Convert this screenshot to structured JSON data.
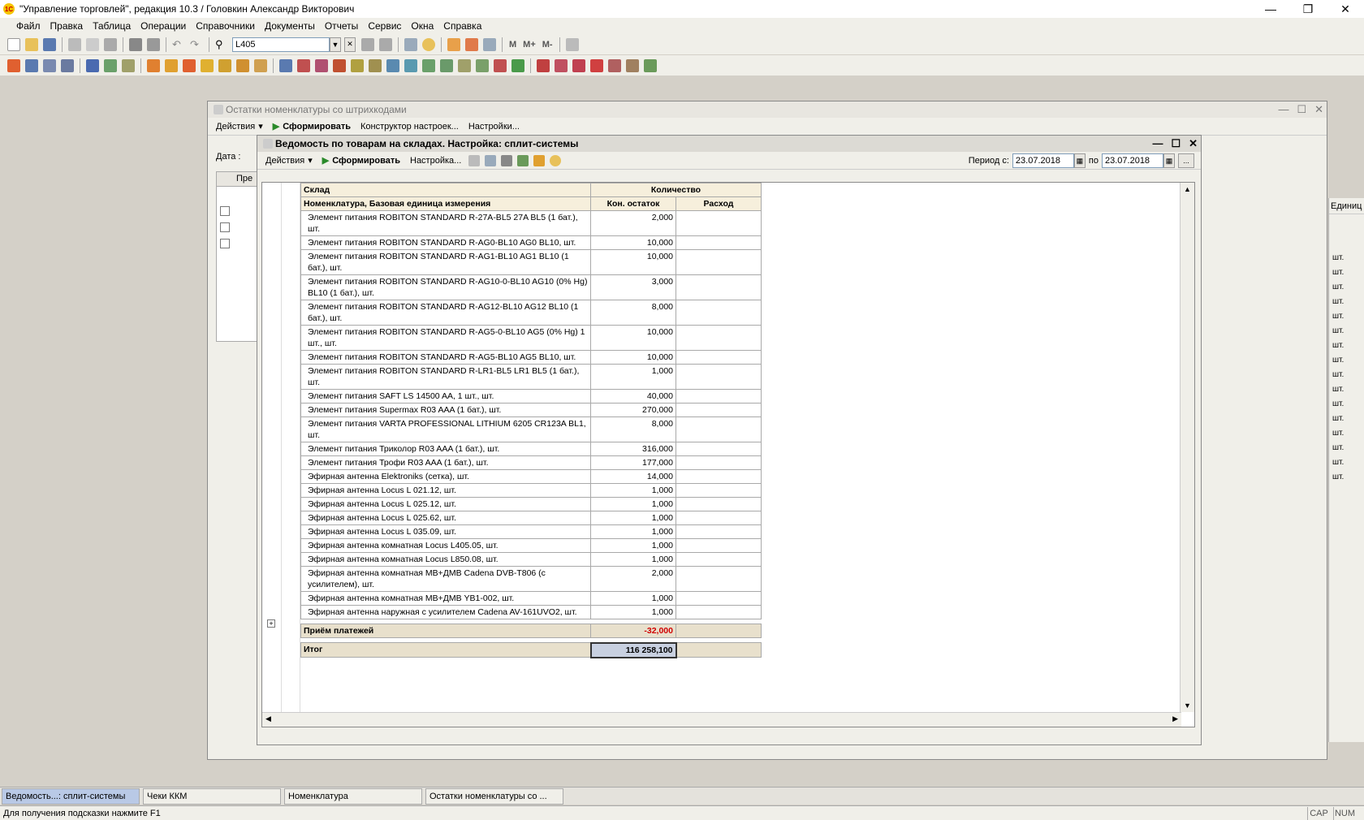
{
  "app": {
    "title": "\"Управление торговлей\", редакция 10.3 / Головкин Александр Викторович",
    "logo": "1С"
  },
  "menu": [
    "Файл",
    "Правка",
    "Таблица",
    "Операции",
    "Справочники",
    "Документы",
    "Отчеты",
    "Сервис",
    "Окна",
    "Справка"
  ],
  "search": {
    "value": "L405"
  },
  "bg_window": {
    "title": "Остатки номенклатуры со штрихкодами",
    "actions": "Действия",
    "generate": "Сформировать",
    "constructor": "Конструктор настроек...",
    "settings": "Настройки...",
    "date_label": "Дата :",
    "col_label": "Пре",
    "right_col": "Единиц",
    "unit_values": [
      "шт.",
      "шт.",
      "шт.",
      "шт.",
      "шт.",
      "шт.",
      "шт.",
      "шт.",
      "шт.",
      "шт.",
      "шт.",
      "шт.",
      "шт.",
      "шт.",
      "шт.",
      "шт."
    ]
  },
  "report_window": {
    "title": "Ведомость по товарам на складах. Настройка: сплит-системы",
    "actions": "Действия",
    "generate": "Сформировать",
    "settings": "Настройка...",
    "period_from_label": "Период с:",
    "period_from": "23.07.2018",
    "period_to_label": "по",
    "period_to": "23.07.2018",
    "more": "...",
    "headers": {
      "warehouse": "Склад",
      "quantity": "Количество",
      "nomenclature": "Номенклатура, Базовая единица измерения",
      "end_balance": "Кон. остаток",
      "expense": "Расход"
    },
    "rows": [
      {
        "name": "Элемент питания ROBITON STANDARD R-27A-BL5 27A BL5 (1 бат.), шт.",
        "qty": "2,000"
      },
      {
        "name": "Элемент питания ROBITON STANDARD R-AG0-BL10 AG0 BL10, шт.",
        "qty": "10,000"
      },
      {
        "name": "Элемент питания ROBITON STANDARD R-AG1-BL10 AG1 BL10 (1 бат.), шт.",
        "qty": "10,000"
      },
      {
        "name": "Элемент питания ROBITON STANDARD R-AG10-0-BL10 AG10 (0% Hg) BL10 (1 бат.), шт.",
        "qty": "3,000"
      },
      {
        "name": "Элемент питания ROBITON STANDARD R-AG12-BL10 AG12 BL10 (1 бат.), шт.",
        "qty": "8,000"
      },
      {
        "name": "Элемент питания ROBITON STANDARD R-AG5-0-BL10 AG5 (0% Hg) 1 шт., шт.",
        "qty": "10,000"
      },
      {
        "name": "Элемент питания ROBITON STANDARD R-AG5-BL10 AG5 BL10, шт.",
        "qty": "10,000"
      },
      {
        "name": "Элемент питания ROBITON STANDARD R-LR1-BL5 LR1 BL5 (1 бат.), шт.",
        "qty": "1,000"
      },
      {
        "name": "Элемент питания SAFT LS 14500 AA, 1 шт., шт.",
        "qty": "40,000"
      },
      {
        "name": "Элемент питания Supermax R03 AAA (1 бат.), шт.",
        "qty": "270,000"
      },
      {
        "name": "Элемент питания VARTA PROFESSIONAL LITHIUM 6205 CR123A BL1, шт.",
        "qty": "8,000"
      },
      {
        "name": "Элемент питания Триколор R03 AAA (1 бат.), шт.",
        "qty": "316,000"
      },
      {
        "name": "Элемент питания Трофи R03 AAA (1 бат.), шт.",
        "qty": "177,000"
      },
      {
        "name": "Эфирная антенна Elektroniks (сетка), шт.",
        "qty": "14,000"
      },
      {
        "name": "Эфирная антенна Locus L 021.12, шт.",
        "qty": "1,000"
      },
      {
        "name": "Эфирная антенна Locus L 025.12, шт.",
        "qty": "1,000"
      },
      {
        "name": "Эфирная антенна Locus L 025.62, шт.",
        "qty": "1,000"
      },
      {
        "name": "Эфирная антенна Locus L 035.09, шт.",
        "qty": "1,000"
      },
      {
        "name": "Эфирная антенна комнатная Locus L405.05, шт.",
        "qty": "1,000"
      },
      {
        "name": "Эфирная антенна комнатная Locus L850.08, шт.",
        "qty": "1,000"
      },
      {
        "name": "Эфирная антенна комнатная МВ+ДМВ Cadena DVB-T806 (с усилителем), шт.",
        "qty": "2,000"
      },
      {
        "name": "Эфирная антенна комнатная МВ+ДМВ YB1-002, шт.",
        "qty": "1,000"
      },
      {
        "name": "Эфирная антенна наружная с усилителем Cadena AV-161UVO2, шт.",
        "qty": "1,000"
      }
    ],
    "group": {
      "name": "Приём платежей",
      "qty": "-32,000"
    },
    "total": {
      "label": "Итог",
      "qty": "116 258,100"
    }
  },
  "taskbar": [
    "Ведомость...: сплит-системы",
    "Чеки ККМ",
    "Номенклатура",
    "Остатки номенклатуры со ..."
  ],
  "status": {
    "hint": "Для получения подсказки нажмите F1",
    "cap": "CAP",
    "num": "NUM"
  },
  "colors": {
    "accent": "#2a8a2a",
    "negative": "#d00000",
    "header_bg": "#f6efdc"
  }
}
